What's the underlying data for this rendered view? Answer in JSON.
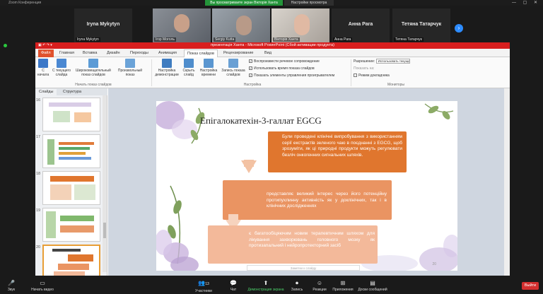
{
  "zoom": {
    "window_title": "Zoom Конференция",
    "share_banner": "Вы просматриваете экран Вікторія Ханта",
    "share_options": "Настройки просмотра",
    "participants": [
      {
        "name": "Iryna Mykytyn",
        "label": "Iryna Mykytyn",
        "video": false
      },
      {
        "name": "",
        "label": "Ігор Моголь",
        "video": true
      },
      {
        "name": "",
        "label": "Sergiy Kutta",
        "video": true
      },
      {
        "name": "",
        "label": "Вікторія Ханта",
        "video": true
      },
      {
        "name": "Анна Раrа",
        "label": "Анна Раrа",
        "video": false
      },
      {
        "name": "Тетяна Татарчук",
        "label": "Тетяна Татарчук",
        "video": false
      }
    ],
    "controls": [
      {
        "icon": "microphone-icon",
        "label": "Звук"
      },
      {
        "icon": "video-icon",
        "label": "Начать видео"
      },
      {
        "icon": "participants-icon",
        "label": "Участники",
        "count": "13"
      },
      {
        "icon": "chat-icon",
        "label": "Чат"
      },
      {
        "icon": "share-screen-icon",
        "label": "Демонстрация экрана"
      },
      {
        "icon": "record-icon",
        "label": "Запись"
      },
      {
        "icon": "reactions-icon",
        "label": "Реакции"
      },
      {
        "icon": "apps-icon",
        "label": "Приложения"
      },
      {
        "icon": "whiteboard-icon",
        "label": "Доски сообщений"
      }
    ],
    "leave_label": "Выйти"
  },
  "powerpoint": {
    "title": "презентація Ханта - Microsoft PowerPoint (Сбой активации продукта)",
    "tabs": [
      "Файл",
      "Главная",
      "Вставка",
      "Дизайн",
      "Переходы",
      "Анимация",
      "Показ слайдов",
      "Рецензирование",
      "Вид"
    ],
    "active_tab": "Показ слайдов",
    "ribbon": {
      "buttons": [
        {
          "label": "С начала",
          "icon": "play-from-start-icon"
        },
        {
          "label": "С текущего слайда",
          "icon": "play-current-icon"
        },
        {
          "label": "Широковещательный показ слайдов",
          "icon": "broadcast-icon"
        },
        {
          "label": "Произвольный показ",
          "icon": "custom-show-icon"
        },
        {
          "label": "Настройка демонстрации",
          "icon": "setup-show-icon"
        },
        {
          "label": "Скрыть слайд",
          "icon": "hide-slide-icon"
        },
        {
          "label": "Настройка времени",
          "icon": "rehearse-timings-icon"
        },
        {
          "label": "Запись показа слайдов",
          "icon": "record-show-icon"
        }
      ],
      "group_start": "Начать показ слайдов",
      "group_setup": "Настройка",
      "group_monitors": "Мониторы",
      "checks": [
        {
          "label": "Воспроизвести речевое сопровождение",
          "checked": true
        },
        {
          "label": "Использовать время показа слайдов",
          "checked": true
        },
        {
          "label": "Показать элементы управления проигрывателем",
          "checked": true
        }
      ],
      "resolution_label": "Разрешение:",
      "resolution_value": "Использовать текуще...",
      "show_on_label": "Показать на:",
      "presenter_view": "Режим докладчика"
    },
    "pane_tabs": [
      "Слайды",
      "Структура"
    ],
    "thumbs": [
      "16",
      "17",
      "18",
      "19",
      "20"
    ],
    "slide": {
      "title": "Епігалокатехін-3-галлат EGCG",
      "box1": "Були проведені клінічні випробування з використанням серії екстрактів зеленого чаю в поєднанні з EGCG, щоб зрозуміти, як ці природні продукти можуть регулювати безліч онкогенних сигнальних шляхів.",
      "box2": "представляє великий інтерес через його потенційну протипухлинну активність як у доклінічних, так і в клінічних дослідженнях",
      "box3": "є багатообіцяючим новим терапевтичним шляхом для лікування захворювань головного мозку як протизапальний і нейропротекторний засіб",
      "number": "20",
      "notes": "Заметки к слайду"
    },
    "colors": {
      "box1": "#e0762e",
      "box2": "#ea9462",
      "box3": "#f3b99a",
      "title_bar": "#d81e1e"
    }
  }
}
